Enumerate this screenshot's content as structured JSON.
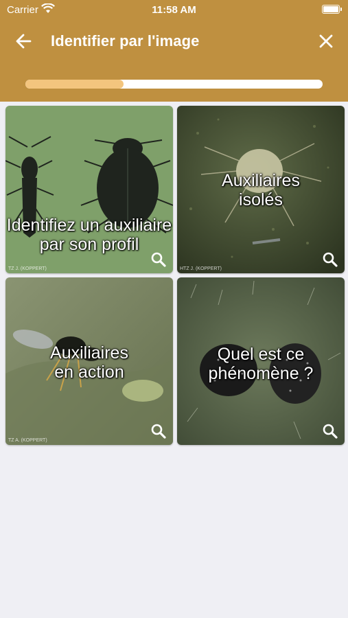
{
  "status_bar": {
    "carrier": "Carrier",
    "time": "11:58 AM"
  },
  "nav": {
    "title": "Identifier par l'image"
  },
  "progress": {
    "fraction": 0.33
  },
  "cards": [
    {
      "label_line1": "Identifiez un auxiliaire",
      "label_line2": "par son profil",
      "credit": "TZ J. (KOPPERT)",
      "icon": "search-icon"
    },
    {
      "label_line1": "Auxiliaires",
      "label_line2": "isolés",
      "credit": "HTZ J. (KOPPERT)",
      "icon": "search-icon"
    },
    {
      "label_line1": "Auxiliaires",
      "label_line2": "en action",
      "credit": "TZ A. (KOPPERT)",
      "icon": "search-icon"
    },
    {
      "label_line1": "Quel est ce",
      "label_line2": "phénomène ?",
      "credit": "",
      "icon": "search-icon"
    }
  ],
  "colors": {
    "header": "#bf9040",
    "progress_fill": "#f3c57e",
    "background": "#efeff4"
  }
}
